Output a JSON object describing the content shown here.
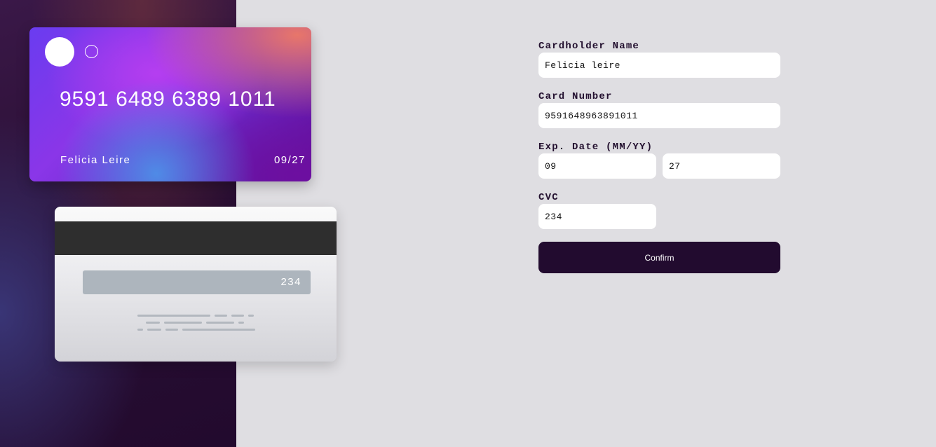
{
  "card_front": {
    "number": "9591 6489 6389 1011",
    "name": "Felicia Leire",
    "expiry": "09/27"
  },
  "card_back": {
    "cvc": "234"
  },
  "form": {
    "name_label": "Cardholder Name",
    "name_value": "Felicia leire",
    "number_label": "Card Number",
    "number_value": "9591648963891011",
    "exp_label": "Exp. Date (MM/YY)",
    "exp_month_value": "09",
    "exp_year_value": "27",
    "cvc_label": "CVC",
    "cvc_value": "234",
    "confirm_label": "Confirm"
  },
  "colors": {
    "background": "#dfdee2",
    "accent_dark": "#220b2f",
    "input_bg": "#ffffff"
  }
}
